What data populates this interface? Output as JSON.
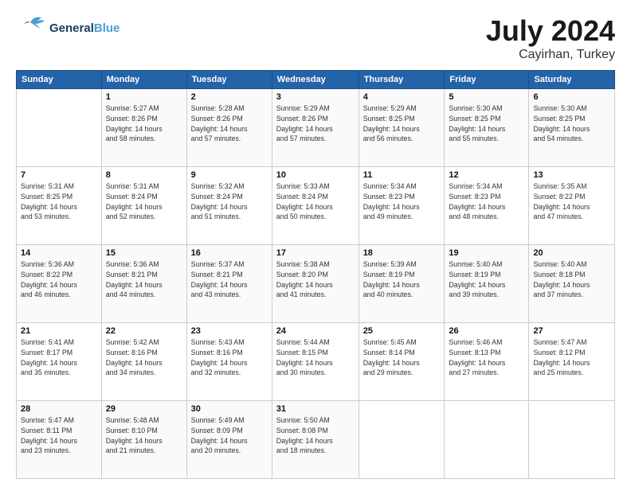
{
  "logo": {
    "text1": "General",
    "text2": "Blue"
  },
  "title": "July 2024",
  "subtitle": "Cayirhan, Turkey",
  "weekdays": [
    "Sunday",
    "Monday",
    "Tuesday",
    "Wednesday",
    "Thursday",
    "Friday",
    "Saturday"
  ],
  "weeks": [
    [
      {
        "date": "",
        "info": ""
      },
      {
        "date": "1",
        "info": "Sunrise: 5:27 AM\nSunset: 8:26 PM\nDaylight: 14 hours\nand 58 minutes."
      },
      {
        "date": "2",
        "info": "Sunrise: 5:28 AM\nSunset: 8:26 PM\nDaylight: 14 hours\nand 57 minutes."
      },
      {
        "date": "3",
        "info": "Sunrise: 5:29 AM\nSunset: 8:26 PM\nDaylight: 14 hours\nand 57 minutes."
      },
      {
        "date": "4",
        "info": "Sunrise: 5:29 AM\nSunset: 8:25 PM\nDaylight: 14 hours\nand 56 minutes."
      },
      {
        "date": "5",
        "info": "Sunrise: 5:30 AM\nSunset: 8:25 PM\nDaylight: 14 hours\nand 55 minutes."
      },
      {
        "date": "6",
        "info": "Sunrise: 5:30 AM\nSunset: 8:25 PM\nDaylight: 14 hours\nand 54 minutes."
      }
    ],
    [
      {
        "date": "7",
        "info": "Sunrise: 5:31 AM\nSunset: 8:25 PM\nDaylight: 14 hours\nand 53 minutes."
      },
      {
        "date": "8",
        "info": "Sunrise: 5:31 AM\nSunset: 8:24 PM\nDaylight: 14 hours\nand 52 minutes."
      },
      {
        "date": "9",
        "info": "Sunrise: 5:32 AM\nSunset: 8:24 PM\nDaylight: 14 hours\nand 51 minutes."
      },
      {
        "date": "10",
        "info": "Sunrise: 5:33 AM\nSunset: 8:24 PM\nDaylight: 14 hours\nand 50 minutes."
      },
      {
        "date": "11",
        "info": "Sunrise: 5:34 AM\nSunset: 8:23 PM\nDaylight: 14 hours\nand 49 minutes."
      },
      {
        "date": "12",
        "info": "Sunrise: 5:34 AM\nSunset: 8:23 PM\nDaylight: 14 hours\nand 48 minutes."
      },
      {
        "date": "13",
        "info": "Sunrise: 5:35 AM\nSunset: 8:22 PM\nDaylight: 14 hours\nand 47 minutes."
      }
    ],
    [
      {
        "date": "14",
        "info": "Sunrise: 5:36 AM\nSunset: 8:22 PM\nDaylight: 14 hours\nand 46 minutes."
      },
      {
        "date": "15",
        "info": "Sunrise: 5:36 AM\nSunset: 8:21 PM\nDaylight: 14 hours\nand 44 minutes."
      },
      {
        "date": "16",
        "info": "Sunrise: 5:37 AM\nSunset: 8:21 PM\nDaylight: 14 hours\nand 43 minutes."
      },
      {
        "date": "17",
        "info": "Sunrise: 5:38 AM\nSunset: 8:20 PM\nDaylight: 14 hours\nand 41 minutes."
      },
      {
        "date": "18",
        "info": "Sunrise: 5:39 AM\nSunset: 8:19 PM\nDaylight: 14 hours\nand 40 minutes."
      },
      {
        "date": "19",
        "info": "Sunrise: 5:40 AM\nSunset: 8:19 PM\nDaylight: 14 hours\nand 39 minutes."
      },
      {
        "date": "20",
        "info": "Sunrise: 5:40 AM\nSunset: 8:18 PM\nDaylight: 14 hours\nand 37 minutes."
      }
    ],
    [
      {
        "date": "21",
        "info": "Sunrise: 5:41 AM\nSunset: 8:17 PM\nDaylight: 14 hours\nand 35 minutes."
      },
      {
        "date": "22",
        "info": "Sunrise: 5:42 AM\nSunset: 8:16 PM\nDaylight: 14 hours\nand 34 minutes."
      },
      {
        "date": "23",
        "info": "Sunrise: 5:43 AM\nSunset: 8:16 PM\nDaylight: 14 hours\nand 32 minutes."
      },
      {
        "date": "24",
        "info": "Sunrise: 5:44 AM\nSunset: 8:15 PM\nDaylight: 14 hours\nand 30 minutes."
      },
      {
        "date": "25",
        "info": "Sunrise: 5:45 AM\nSunset: 8:14 PM\nDaylight: 14 hours\nand 29 minutes."
      },
      {
        "date": "26",
        "info": "Sunrise: 5:46 AM\nSunset: 8:13 PM\nDaylight: 14 hours\nand 27 minutes."
      },
      {
        "date": "27",
        "info": "Sunrise: 5:47 AM\nSunset: 8:12 PM\nDaylight: 14 hours\nand 25 minutes."
      }
    ],
    [
      {
        "date": "28",
        "info": "Sunrise: 5:47 AM\nSunset: 8:11 PM\nDaylight: 14 hours\nand 23 minutes."
      },
      {
        "date": "29",
        "info": "Sunrise: 5:48 AM\nSunset: 8:10 PM\nDaylight: 14 hours\nand 21 minutes."
      },
      {
        "date": "30",
        "info": "Sunrise: 5:49 AM\nSunset: 8:09 PM\nDaylight: 14 hours\nand 20 minutes."
      },
      {
        "date": "31",
        "info": "Sunrise: 5:50 AM\nSunset: 8:08 PM\nDaylight: 14 hours\nand 18 minutes."
      },
      {
        "date": "",
        "info": ""
      },
      {
        "date": "",
        "info": ""
      },
      {
        "date": "",
        "info": ""
      }
    ]
  ]
}
